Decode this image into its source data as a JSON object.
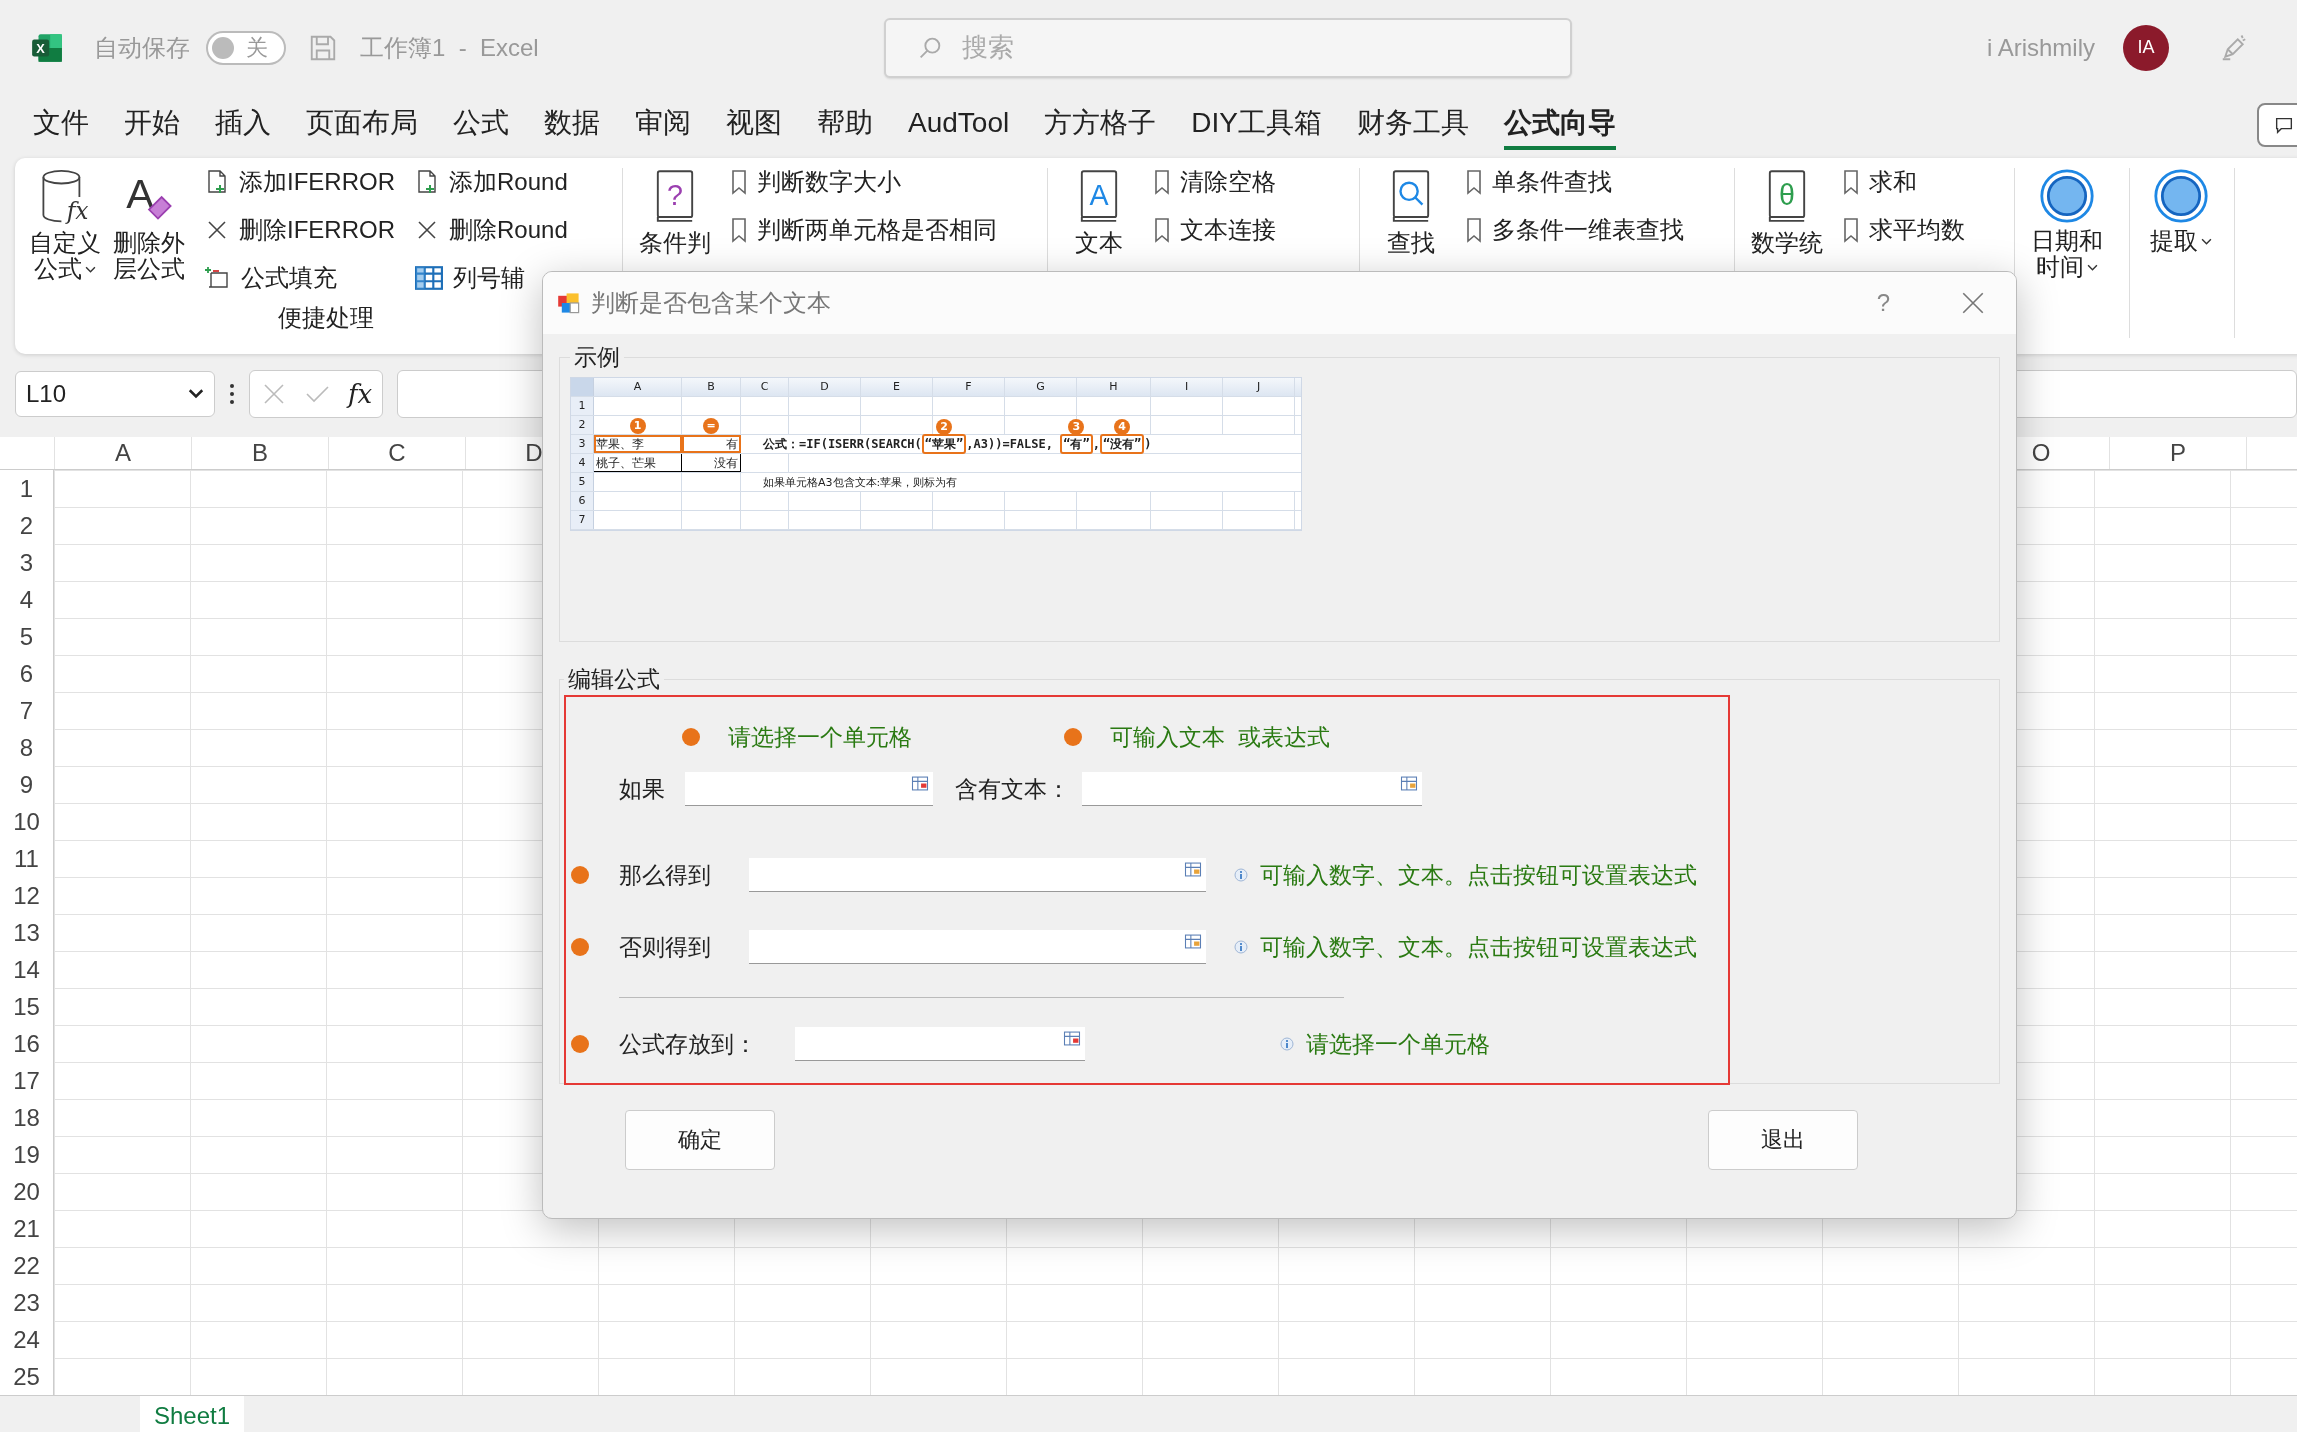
{
  "title_bar": {
    "app_icon_letter": "X",
    "autosave_label": "自动保存",
    "autosave_on": false,
    "autosave_state": "关",
    "document_title": "工作簿1  -  Excel",
    "search_placeholder": "搜索",
    "user_name": "i Arishmily",
    "avatar_initials": "IA"
  },
  "menu_tabs": [
    {
      "label": "文件",
      "selected": false
    },
    {
      "label": "开始",
      "selected": false
    },
    {
      "label": "插入",
      "selected": false
    },
    {
      "label": "页面布局",
      "selected": false
    },
    {
      "label": "公式",
      "selected": false
    },
    {
      "label": "数据",
      "selected": false
    },
    {
      "label": "审阅",
      "selected": false
    },
    {
      "label": "视图",
      "selected": false
    },
    {
      "label": "帮助",
      "selected": false
    },
    {
      "label": "AudTool",
      "selected": false
    },
    {
      "label": "方方格子",
      "selected": false
    },
    {
      "label": "DIY工具箱",
      "selected": false
    },
    {
      "label": "财务工具",
      "selected": false
    },
    {
      "label": "公式向导",
      "selected": true
    }
  ],
  "ribbon": {
    "groups": [
      {
        "label": "便捷处理",
        "large": [
          {
            "lines": [
              "自定义",
              "公式"
            ],
            "dropdown": true,
            "glyph": "fx"
          },
          {
            "lines": [
              "删除外",
              "层公式"
            ],
            "dropdown": false,
            "glyph": "A"
          }
        ],
        "columns": [
          [
            "添加IFERROR",
            "删除IFERROR",
            "公式填充"
          ],
          [
            "添加Round",
            "删除Round",
            "列号辅"
          ]
        ]
      },
      {
        "large": [
          {
            "lines": [
              "条件判"
            ],
            "dropdown": false,
            "glyph": "?"
          }
        ],
        "columns": [
          [
            "判断数字大小",
            "判断两单元格是否相同"
          ]
        ]
      },
      {
        "large": [
          {
            "lines": [
              "文本"
            ],
            "dropdown": false,
            "glyph": "A"
          }
        ],
        "columns": [
          [
            "清除空格",
            "文本连接"
          ]
        ]
      },
      {
        "large": [
          {
            "lines": [
              "查找"
            ],
            "dropdown": false
          }
        ],
        "columns": [
          [
            "单条件查找",
            "多条件一维表查找"
          ]
        ]
      },
      {
        "large": [
          {
            "lines": [
              "数学统"
            ],
            "dropdown": false,
            "glyph": "θ"
          }
        ],
        "columns": [
          [
            "求和",
            "求平均数"
          ]
        ]
      },
      {
        "large": [
          {
            "lines": [
              "日期和",
              "时间"
            ],
            "dropdown": true
          }
        ]
      },
      {
        "large": [
          {
            "lines": [
              "提取"
            ],
            "dropdown": true
          }
        ]
      }
    ]
  },
  "formula_bar": {
    "name_box": "L10",
    "function_label": "fx"
  },
  "sheet": {
    "column_headers": [
      "A",
      "B",
      "C",
      "D",
      "O",
      "P"
    ],
    "row_headers": [
      "1",
      "2",
      "3",
      "4",
      "5",
      "6",
      "7",
      "8",
      "9",
      "10",
      "11",
      "12",
      "13",
      "14",
      "15",
      "16",
      "17",
      "18",
      "19",
      "20",
      "21",
      "22",
      "23",
      "24",
      "25"
    ],
    "sheet_tabs": [
      {
        "label": "Sheet1",
        "selected": true
      }
    ]
  },
  "dialog": {
    "title": "判断是否包含某个文本",
    "help": "?",
    "example": {
      "legend": "示例",
      "columns": [
        "A",
        "B",
        "C",
        "D",
        "E",
        "F",
        "G",
        "H",
        "I",
        "J"
      ],
      "rows": [
        "1",
        "2",
        "3",
        "4",
        "5",
        "6",
        "7"
      ],
      "cells": [
        {
          "text": "苹果、李",
          "boxed": true,
          "badge": "1"
        },
        {
          "text": "有",
          "boxed": true,
          "badge": "="
        },
        {
          "text": "桃子、芒果",
          "boxed": false
        },
        {
          "text": "没有",
          "boxed": false
        }
      ],
      "formula": [
        {
          "text": "公式：=IF(ISERR(SEARCH(",
          "boxed": false
        },
        {
          "text": "“苹果”",
          "boxed": true,
          "badge": "2"
        },
        {
          "text": ",A3))=FALSE, ",
          "boxed": false
        },
        {
          "text": "“有”",
          "boxed": true,
          "badge": "3"
        },
        {
          "text": ",",
          "boxed": false
        },
        {
          "text": "“没有”",
          "boxed": true,
          "badge": "4"
        },
        {
          "text": ")",
          "boxed": false
        }
      ],
      "note": "如果单元格A3包含文本:苹果，则标为有"
    },
    "edit": {
      "legend": "编辑公式",
      "top_hints": [
        "请选择一个单元格",
        "可输入文本  或表达式"
      ],
      "fields": [
        {
          "label": "如果"
        },
        {
          "label": "含有文本："
        },
        {
          "label": "那么得到",
          "hint": "可输入数字、文本。点击按钮可设置表达式"
        },
        {
          "label": "否则得到",
          "hint": "可输入数字、文本。点击按钮可设置表达式"
        },
        {
          "label": "公式存放到：",
          "hint": "请选择一个单元格"
        }
      ]
    },
    "buttons": [
      "确定",
      "退出"
    ]
  }
}
